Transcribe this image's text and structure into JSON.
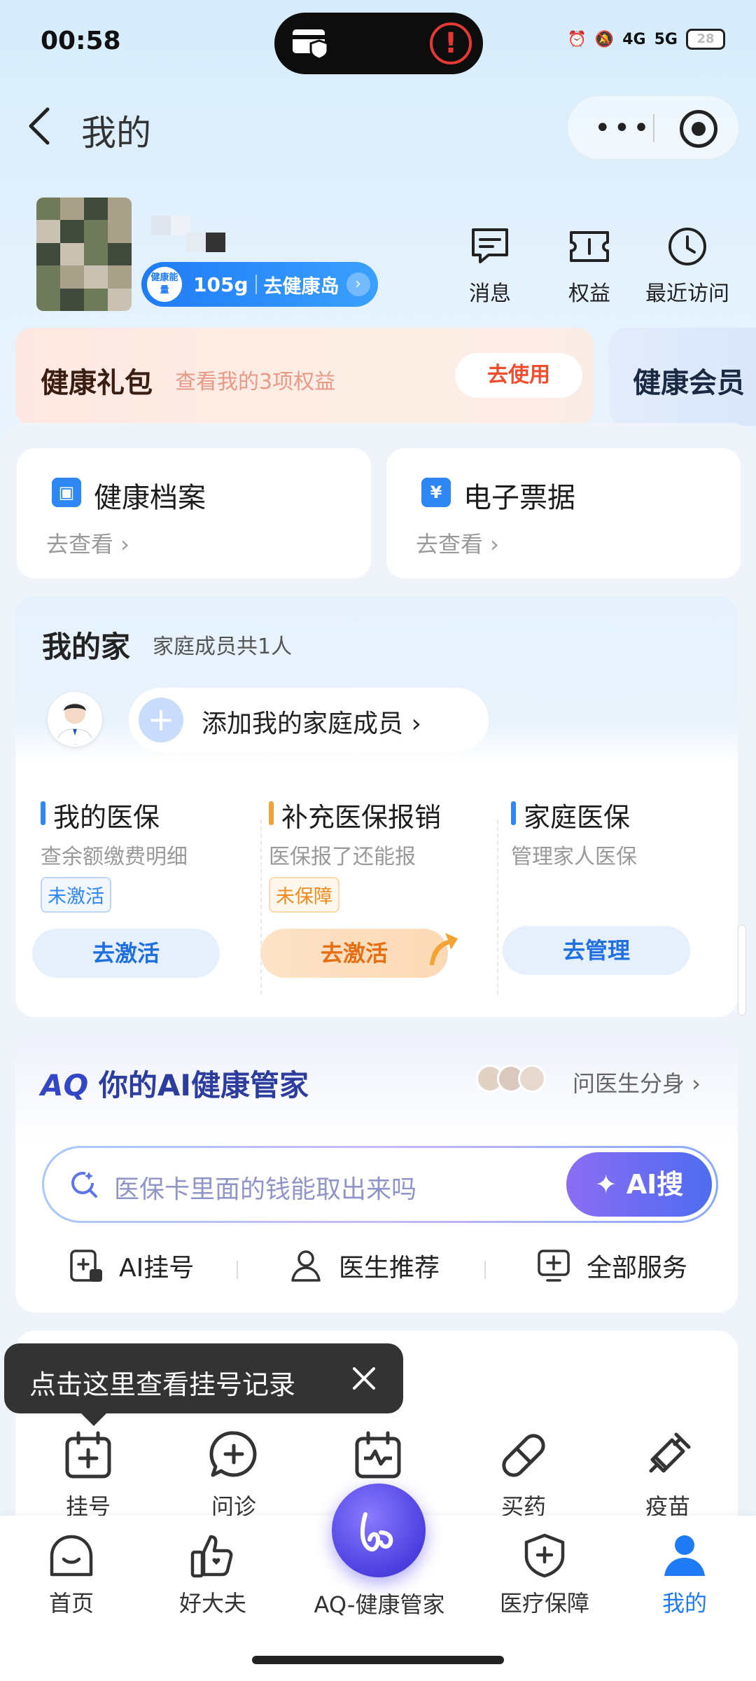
{
  "status_bar": {
    "time": "00:58",
    "battery": "28",
    "network": [
      "4G",
      "5G"
    ]
  },
  "header": {
    "title": "我的",
    "more_icon": "more-dots-icon",
    "target_icon": "mini-program-close-icon"
  },
  "profile": {
    "energy_badge": "健康能量",
    "energy_value": "105g",
    "energy_link": "去健康岛",
    "quick_links": [
      {
        "label": "消息",
        "icon": "message-icon"
      },
      {
        "label": "权益",
        "icon": "benefits-icon"
      },
      {
        "label": "最近访问",
        "icon": "clock-icon"
      }
    ]
  },
  "promo": {
    "gift_title": "健康礼包",
    "gift_sub": "查看我的3项权益",
    "gift_button": "去使用",
    "member_title": "健康会员"
  },
  "cards": [
    {
      "title": "健康档案",
      "sub": "去查看 ›",
      "icon": "health-record-icon"
    },
    {
      "title": "电子票据",
      "sub": "去查看 ›",
      "icon": "e-receipt-icon"
    }
  ],
  "family": {
    "title": "我的家",
    "count": "家庭成员共1人",
    "add_label": "添加我的家庭成员 ›",
    "insurance": [
      {
        "title": "我的医保",
        "sub": "查余额缴费明细",
        "tag": "未激活",
        "button": "去激活",
        "color": "#2f87f5"
      },
      {
        "title": "补充医保报销",
        "sub": "医保报了还能报",
        "tag": "未保障",
        "button": "去激活",
        "color": "#f5a234"
      },
      {
        "title": "家庭医保",
        "sub": "管理家人医保",
        "tag": "",
        "button": "去管理",
        "color": "#2f87f5"
      }
    ]
  },
  "ai": {
    "brand": "AQ",
    "title": "你的AI健康管家",
    "link": "问医生分身 ›",
    "search_placeholder": "医保卡里面的钱能取出来吗",
    "search_button": "✦ AI搜",
    "services": [
      {
        "label": "AI挂号",
        "icon": "ai-register-icon"
      },
      {
        "label": "医生推荐",
        "icon": "doctor-icon"
      },
      {
        "label": "全部服务",
        "icon": "all-services-icon"
      }
    ]
  },
  "tooltip": {
    "text": "点击这里查看挂号记录"
  },
  "services": [
    {
      "label": "挂号",
      "icon": "register-calendar-icon"
    },
    {
      "label": "问诊",
      "icon": "consult-chat-icon"
    },
    {
      "label": "",
      "icon": "checkup-calendar-icon"
    },
    {
      "label": "买药",
      "icon": "pill-icon"
    },
    {
      "label": "疫苗",
      "icon": "vaccine-icon"
    }
  ],
  "tabbar": {
    "items": [
      {
        "label": "首页",
        "icon": "home-smile-icon"
      },
      {
        "label": "好大夫",
        "icon": "thumbs-heart-icon"
      },
      {
        "label": "AQ-健康管家",
        "icon": "aq-logo-icon"
      },
      {
        "label": "医疗保障",
        "icon": "shield-plus-icon"
      },
      {
        "label": "我的",
        "icon": "person-icon"
      }
    ],
    "active_color": "#1f7bf5"
  }
}
